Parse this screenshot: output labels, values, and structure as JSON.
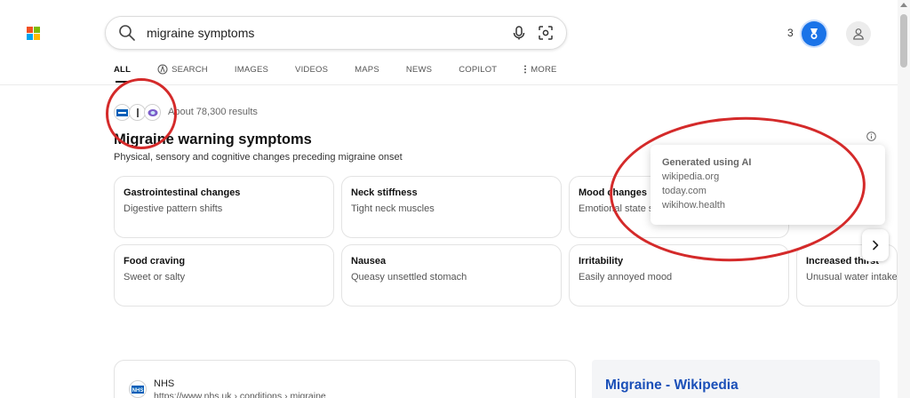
{
  "search": {
    "query": "migraine symptoms"
  },
  "header": {
    "rewards_count": "3"
  },
  "nav": {
    "tabs": [
      {
        "label": "ALL"
      },
      {
        "label": "SEARCH"
      },
      {
        "label": "IMAGES"
      },
      {
        "label": "VIDEOS"
      },
      {
        "label": "MAPS"
      },
      {
        "label": "NEWS"
      },
      {
        "label": "COPILOT"
      },
      {
        "label": "MORE"
      }
    ]
  },
  "results_info": {
    "count_text": "About 78,300 results"
  },
  "answer": {
    "title": "Migraine warning symptoms",
    "subtitle": "Physical, sensory and cognitive changes preceding migraine onset"
  },
  "cards": [
    {
      "title": "Gastrointestinal changes",
      "desc": "Digestive pattern shifts"
    },
    {
      "title": "Neck stiffness",
      "desc": "Tight neck muscles"
    },
    {
      "title": "Mood changes",
      "desc": "Emotional state shifts"
    },
    {
      "title": "Food craving",
      "desc": "Sweet or salty"
    },
    {
      "title": "Nausea",
      "desc": "Queasy unsettled stomach"
    },
    {
      "title": "Irritability",
      "desc": "Easily annoyed mood"
    },
    {
      "title": "Increased thirst",
      "desc": "Unusual water intake"
    }
  ],
  "ai_popup": {
    "title": "Generated using AI",
    "sources": [
      "wikipedia.org",
      "today.com",
      "wikihow.health"
    ]
  },
  "result": {
    "site_name": "NHS",
    "url": "https://www.nhs.uk › conditions › migraine",
    "favicon_text": "NHS"
  },
  "wiki_panel": {
    "title": "Migraine - Wikipedia"
  },
  "colors": {
    "accent_blue": "#1a73e8",
    "annotation_red": "#d42a2a",
    "wiki_link": "#1a4fb8"
  },
  "icons": {
    "search": "search-icon",
    "mic": "microphone-icon",
    "visual": "visual-search-icon",
    "rewards": "rewards-medal-icon",
    "profile": "profile-icon",
    "info": "info-icon",
    "next": "chevron-right-icon",
    "copilot": "copilot-icon",
    "more": "more-vertical-icon"
  }
}
